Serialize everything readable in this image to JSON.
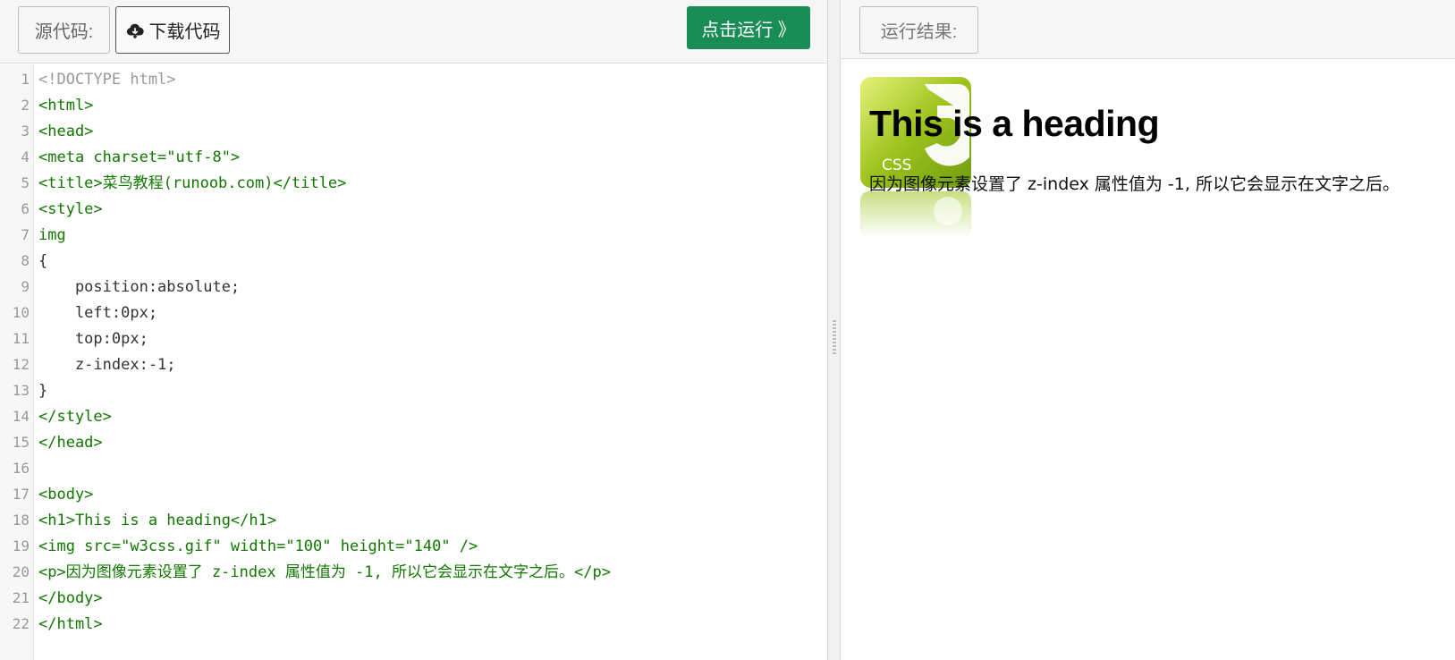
{
  "toolbar": {
    "source_label": "源代码:",
    "download_label": "下载代码",
    "run_label": "点击运行 》",
    "result_label": "运行结果:"
  },
  "colors": {
    "run_button": "#1a8c55",
    "tag": "#117700",
    "attr": "#0000cc",
    "string": "#aa1111"
  },
  "icons": {
    "download": "cloud-download-icon"
  },
  "code": [
    "<!DOCTYPE html>",
    "<html>",
    "<head>",
    "<meta charset=\"utf-8\">",
    "<title>菜鸟教程(runoob.com)</title>",
    "<style>",
    "img",
    "{",
    "    position:absolute;",
    "    left:0px;",
    "    top:0px;",
    "    z-index:-1;",
    "}",
    "</style>",
    "</head>",
    "",
    "<body>",
    "<h1>This is a heading</h1>",
    "<img src=\"w3css.gif\" width=\"100\" height=\"140\" />",
    "<p>因为图像元素设置了 z-index 属性值为 -1, 所以它会显示在文字之后。</p>",
    "</body>",
    "</html>"
  ],
  "preview": {
    "heading": "This is a heading",
    "paragraph": "因为图像元素设置了 z-index 属性值为 -1, 所以它会显示在文字之后。",
    "logo_text": "CSS"
  }
}
